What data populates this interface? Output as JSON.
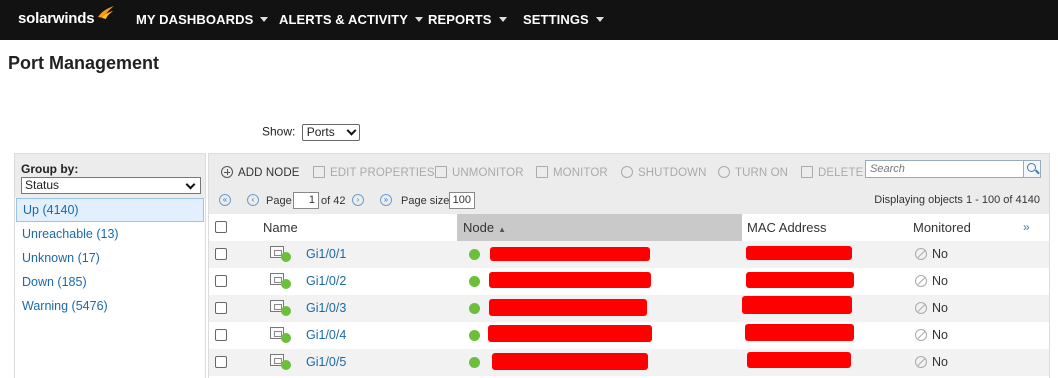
{
  "nav": {
    "logo": "solarwinds",
    "items": [
      {
        "label": "MY DASHBOARDS"
      },
      {
        "label": "ALERTS & ACTIVITY"
      },
      {
        "label": "REPORTS"
      },
      {
        "label": "SETTINGS"
      }
    ]
  },
  "page": {
    "title": "Port Management"
  },
  "show": {
    "label": "Show:",
    "value": "Ports"
  },
  "group_by": {
    "label": "Group by:",
    "value": "Status",
    "items": [
      {
        "label": "Up (4140)",
        "active": true
      },
      {
        "label": "Unreachable (13)"
      },
      {
        "label": "Unknown (17)"
      },
      {
        "label": "Down (185)"
      },
      {
        "label": "Warning (5476)"
      }
    ]
  },
  "toolbar": {
    "add_node": "ADD NODE",
    "edit_properties": "EDIT PROPERTIES",
    "unmonitor": "UNMONITOR",
    "monitor": "MONITOR",
    "shutdown": "SHUTDOWN",
    "turn_on": "TURN ON",
    "delete": "DELETE",
    "search_placeholder": "Search"
  },
  "pager": {
    "page_label": "Page",
    "page_value": "1",
    "of_pages": "of 42",
    "page_size_label": "Page size",
    "page_size": "100",
    "displaying": "Displaying objects 1 - 100 of 4140"
  },
  "table": {
    "columns": {
      "name": "Name",
      "node": "Node",
      "mac": "MAC Address",
      "monitored": "Monitored",
      "more": "»"
    },
    "rows": [
      {
        "name": "Gi1/0/1",
        "monitored": "No"
      },
      {
        "name": "Gi1/0/2",
        "monitored": "No"
      },
      {
        "name": "Gi1/0/3",
        "monitored": "No"
      },
      {
        "name": "Gi1/0/4",
        "monitored": "No"
      },
      {
        "name": "Gi1/0/5",
        "monitored": "No"
      }
    ]
  },
  "colors": {
    "accent": "#1a6aa8",
    "status_up": "#6bbf3b",
    "redaction": "#ff0000",
    "topbar": "#121212"
  }
}
